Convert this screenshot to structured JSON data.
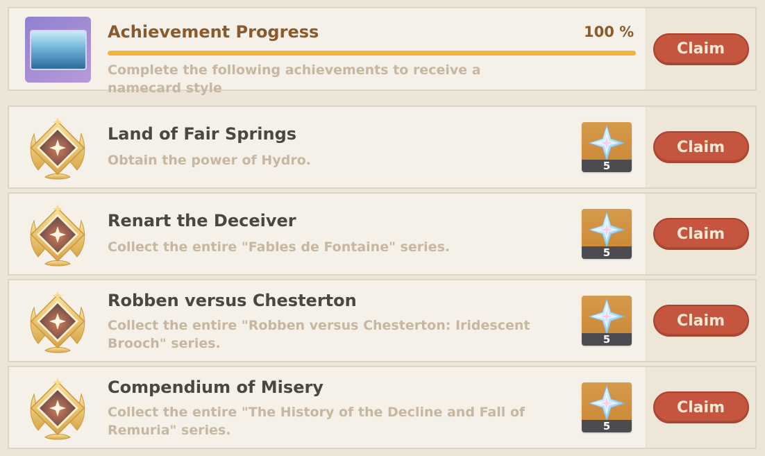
{
  "header": {
    "title": "Achievement Progress",
    "progress_text": "100 %",
    "progress_fraction": 1.0,
    "description": "Complete the following achievements to receive a namecard style",
    "claim_label": "Claim"
  },
  "achievements": [
    {
      "title": "Land of Fair Springs",
      "description": "Obtain the power of Hydro.",
      "reward_icon": "primogem-icon",
      "reward_count": "5",
      "claim_label": "Claim"
    },
    {
      "title": "Renart the Deceiver",
      "description": "Collect the entire \"Fables de Fontaine\" series.",
      "reward_icon": "primogem-icon",
      "reward_count": "5",
      "claim_label": "Claim"
    },
    {
      "title": "Robben versus Chesterton",
      "description": "Collect the entire \"Robben versus Chesterton: Iridescent Brooch\" series.",
      "reward_icon": "primogem-icon",
      "reward_count": "5",
      "claim_label": "Claim"
    },
    {
      "title": "Compendium of Misery",
      "description": "Collect the entire \"The History of the Decline and Fall of Remuria\" series.",
      "reward_icon": "primogem-icon",
      "reward_count": "5",
      "claim_label": "Claim"
    }
  ],
  "colors": {
    "claim_button": "#c5553f",
    "progress_bar": "#f0b43a",
    "title_text": "#4b4644",
    "description_text": "#c7b7a1"
  }
}
